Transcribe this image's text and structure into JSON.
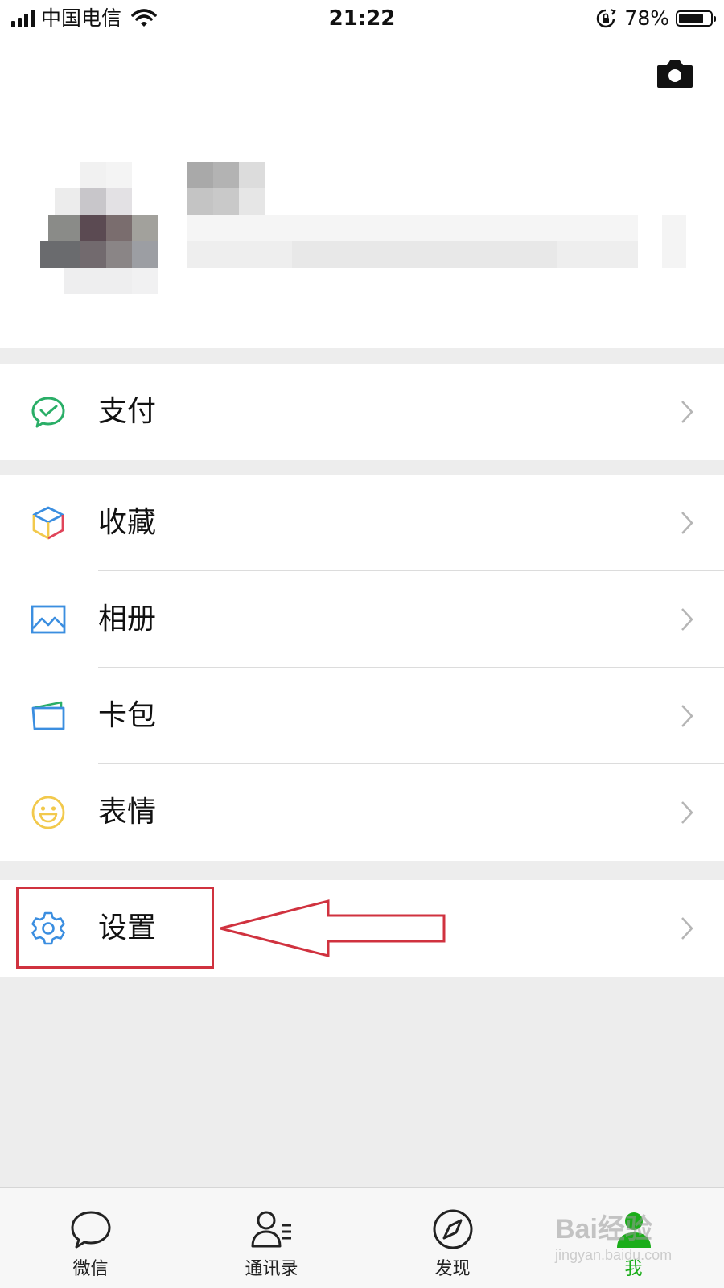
{
  "status_bar": {
    "carrier": "中国电信",
    "time": "21:22",
    "battery_percent": "78%",
    "battery_level": 0.78,
    "icons": [
      "signal-icon",
      "wifi-icon",
      "rotation-lock-icon",
      "battery-icon"
    ]
  },
  "profile": {
    "camera_icon": "camera-icon",
    "avatar": "pixelated-avatar",
    "name": "pixelated-name"
  },
  "menu": {
    "pay": {
      "label": "支付",
      "icon": "wechat-pay-icon",
      "color": "#2aae67"
    },
    "favorites": {
      "label": "收藏",
      "icon": "cube-icon"
    },
    "album": {
      "label": "相册",
      "icon": "photo-icon",
      "color": "#3b8ee0"
    },
    "cards": {
      "label": "卡包",
      "icon": "card-wallet-icon",
      "color": "#3b8ee0"
    },
    "stickers": {
      "label": "表情",
      "icon": "smiley-icon",
      "color": "#f2c94c"
    },
    "settings": {
      "label": "设置",
      "icon": "gear-icon",
      "color": "#3b8ee0"
    }
  },
  "annotation": {
    "color": "#d0323f"
  },
  "tabs": [
    {
      "label": "微信",
      "icon": "chat-bubble-icon"
    },
    {
      "label": "通讯录",
      "icon": "contacts-icon"
    },
    {
      "label": "发现",
      "icon": "compass-icon"
    },
    {
      "label": "我",
      "icon": "person-icon",
      "active": true
    }
  ],
  "watermark": {
    "text": "Bai经验",
    "url": "jingyan.baidu.com"
  },
  "colors": {
    "accent": "#1aad19",
    "background": "#ededed"
  }
}
